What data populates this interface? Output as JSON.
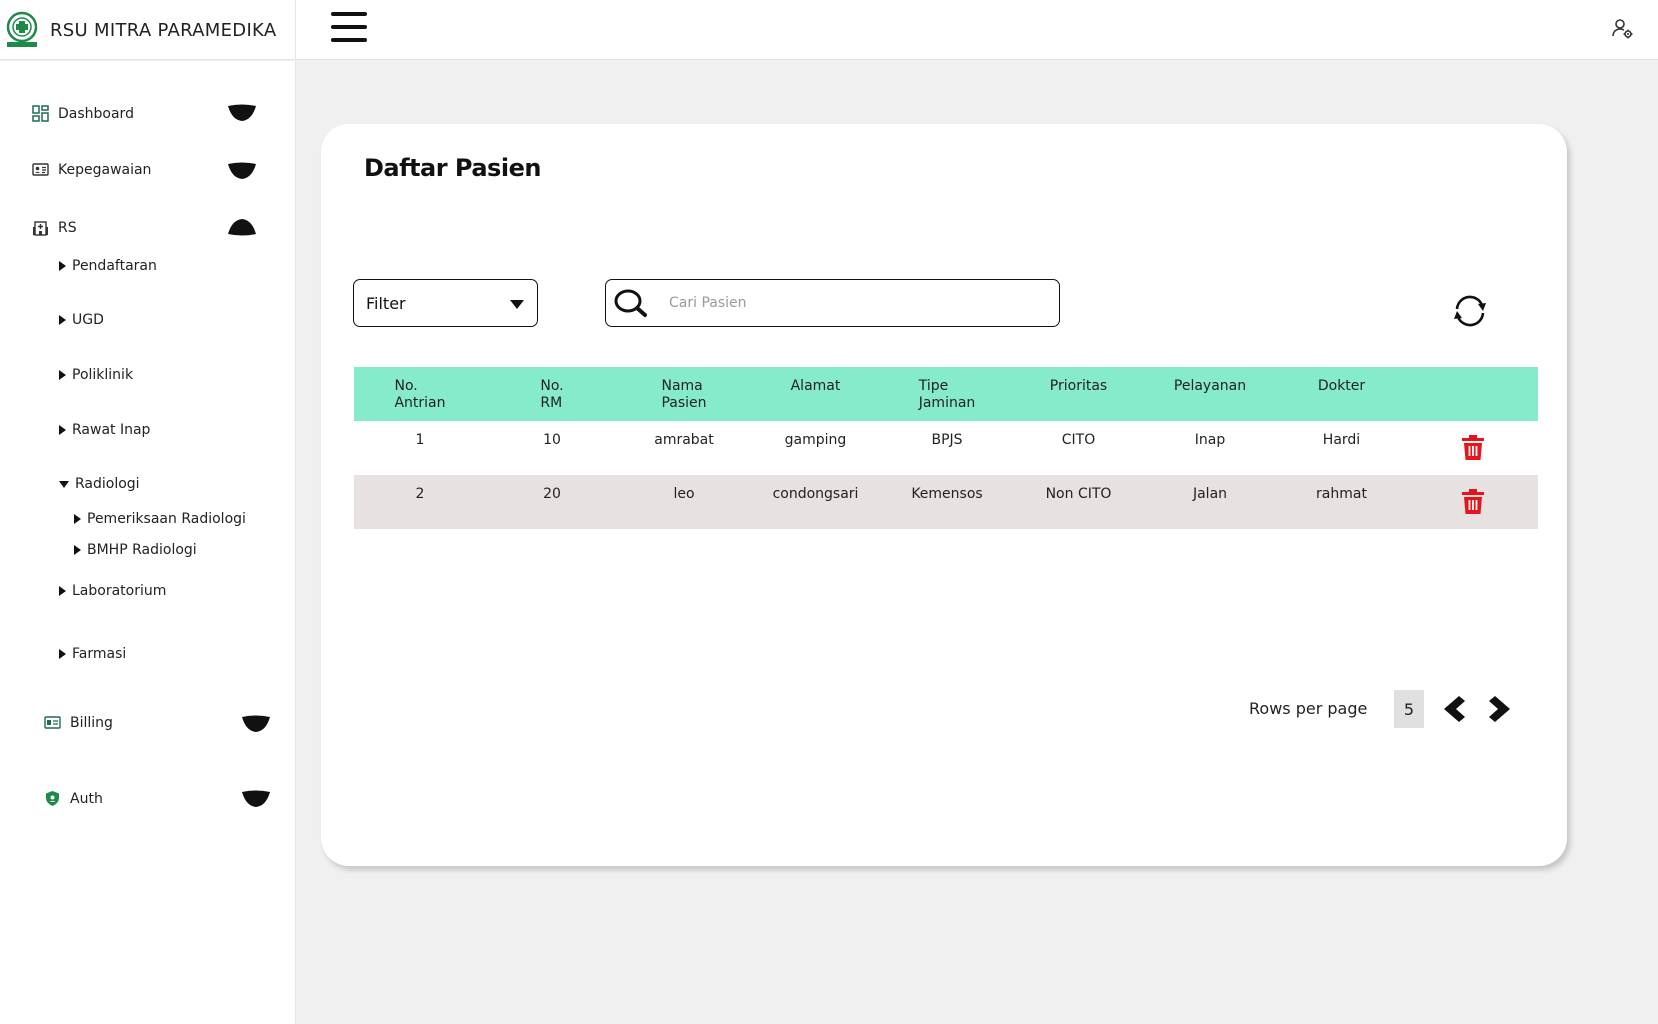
{
  "header": {
    "brand_name": "RSU MITRA PARAMEDIKA",
    "logo_icon": "hospital-crest-logo",
    "menu_icon": "hamburger-icon",
    "user_icon": "user-settings-icon"
  },
  "sidebar": {
    "items": [
      {
        "label": "Dashboard",
        "icon": "dashboard-icon",
        "expanded": false
      },
      {
        "label": "Kepegawaian",
        "icon": "id-card-icon",
        "expanded": false
      },
      {
        "label": "RS",
        "icon": "hospital-icon",
        "expanded": true
      },
      {
        "label": "Billing",
        "icon": "billing-icon",
        "expanded": false
      },
      {
        "label": "Auth",
        "icon": "shield-icon",
        "expanded": false
      }
    ],
    "rs_children": [
      {
        "label": "Pendaftaran"
      },
      {
        "label": "UGD"
      },
      {
        "label": "Poliklinik"
      },
      {
        "label": "Rawat Inap"
      },
      {
        "label": "Radiologi",
        "expanded": true
      },
      {
        "label": "Laboratorium"
      },
      {
        "label": "Farmasi"
      }
    ],
    "radiologi_children": [
      {
        "label": "Pemeriksaan Radiologi"
      },
      {
        "label": "BMHP Radiologi"
      }
    ]
  },
  "main": {
    "title": "Daftar Pasien",
    "filter_label": "Filter",
    "search_placeholder": "Cari Pasien",
    "search_value": "",
    "table": {
      "headers": [
        [
          "No.",
          "Antrian"
        ],
        [
          "No.",
          "RM"
        ],
        [
          "Nama",
          "Pasien"
        ],
        [
          "Alamat"
        ],
        [
          "Tipe",
          "Jaminan"
        ],
        [
          "Prioritas"
        ],
        [
          "Pelayanan"
        ],
        [
          "Dokter"
        ],
        []
      ],
      "rows": [
        [
          "1",
          "10",
          "amrabat",
          "gamping",
          "BPJS",
          "CITO",
          "Inap",
          "Hardi"
        ],
        [
          "2",
          "20",
          "leo",
          "condongsari",
          "Kemensos",
          "Non CITO",
          "Jalan",
          "rahmat"
        ]
      ]
    },
    "pagination": {
      "rows_per_page_label": "Rows per page",
      "rows_per_page_value": "5"
    }
  },
  "colors": {
    "table_header_bg": "#86ebcc",
    "alt_row_bg": "#e8e1e1",
    "delete_icon": "#e8141b",
    "brand_green": "#1e8a4a"
  }
}
